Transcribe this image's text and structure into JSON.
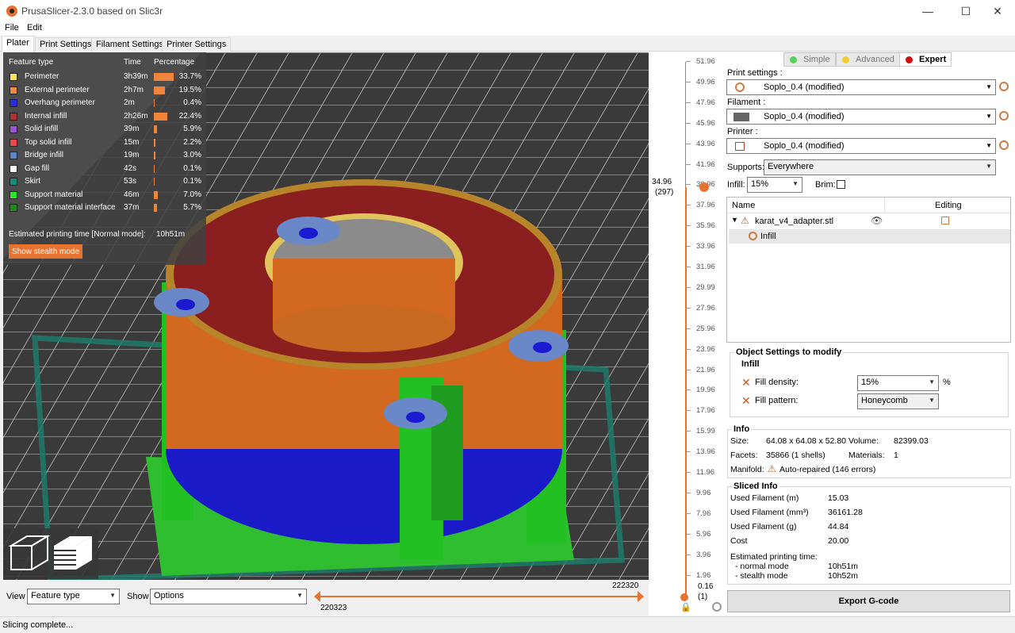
{
  "window": {
    "title": "PrusaSlicer-2.3.0 based on Slic3r",
    "minimize": "—",
    "maximize": "☐",
    "close": "✕"
  },
  "menu": {
    "file": "File",
    "edit": "Edit"
  },
  "tabs": [
    "Plater",
    "Print Settings",
    "Filament Settings",
    "Printer Settings"
  ],
  "legend": {
    "headers": {
      "feature": "Feature type",
      "time": "Time",
      "percentage": "Percentage"
    },
    "rows": [
      {
        "name": "Perimeter",
        "time": "3h39m",
        "pct": "33.7%",
        "value": 33.7,
        "color": "#ffe55a"
      },
      {
        "name": "External perimeter",
        "time": "2h7m",
        "pct": "19.5%",
        "value": 19.5,
        "color": "#f28a40"
      },
      {
        "name": "Overhang perimeter",
        "time": "2m",
        "pct": "0.4%",
        "value": 0.4,
        "color": "#2a2ae6"
      },
      {
        "name": "Internal infill",
        "time": "2h26m",
        "pct": "22.4%",
        "value": 22.4,
        "color": "#b03030"
      },
      {
        "name": "Solid infill",
        "time": "39m",
        "pct": "5.9%",
        "value": 5.9,
        "color": "#9a54d8"
      },
      {
        "name": "Top solid infill",
        "time": "15m",
        "pct": "2.2%",
        "value": 2.2,
        "color": "#f04848"
      },
      {
        "name": "Bridge infill",
        "time": "19m",
        "pct": "3.0%",
        "value": 3.0,
        "color": "#5a86c8"
      },
      {
        "name": "Gap fill",
        "time": "42s",
        "pct": "0.1%",
        "value": 0.1,
        "color": "#ffffff"
      },
      {
        "name": "Skirt",
        "time": "53s",
        "pct": "0.1%",
        "value": 0.1,
        "color": "#188a78"
      },
      {
        "name": "Support material",
        "time": "46m",
        "pct": "7.0%",
        "value": 7.0,
        "color": "#28e828"
      },
      {
        "name": "Support material interface",
        "time": "37m",
        "pct": "5.7%",
        "value": 5.7,
        "color": "#1e8a1e"
      }
    ],
    "estimated_label": "Estimated printing time [Normal mode]:",
    "estimated_value": "10h51m",
    "stealth_button": "Show stealth mode"
  },
  "viewbar": {
    "view_label": "View",
    "view_value": "Feature type",
    "show_label": "Show",
    "show_value": "Options",
    "range_start": "220323",
    "range_end": "222320"
  },
  "vslider": {
    "ticks": [
      "51.96",
      "49.96",
      "47.96",
      "45.96",
      "43.96",
      "41.96",
      "39.96",
      "37.96",
      "35.96",
      "33.96",
      "31.96",
      "29.99",
      "27.96",
      "25.96",
      "23.96",
      "21.96",
      "19.96",
      "17.96",
      "15.99",
      "13.96",
      "11.96",
      "9.96",
      "7.96",
      "5.96",
      "3.96",
      "1.96"
    ],
    "current_height": "34.96",
    "current_layer": "(297)",
    "bottom_height": "0.16",
    "bottom_layer": "(1)"
  },
  "modes": {
    "simple": "Simple",
    "advanced": "Advanced",
    "expert": "Expert"
  },
  "settings": {
    "print_label": "Print settings :",
    "print_value": "Soplo_0.4 (modified)",
    "filament_label": "Filament :",
    "filament_value": "Soplo_0.4 (modified)",
    "printer_label": "Printer :",
    "printer_value": "Soplo_0.4 (modified)",
    "supports_label": "Supports:",
    "supports_value": "Everywhere",
    "infill_label": "Infill:",
    "infill_value": "15%",
    "brim_label": "Brim:"
  },
  "objects": {
    "col_name": "Name",
    "col_editing": "Editing",
    "object_name": "karat_v4_adapter.stl",
    "child_name": "Infill"
  },
  "object_settings": {
    "title": "Object Settings to modify",
    "group": "Infill",
    "density_label": "Fill density:",
    "density_value": "15%",
    "density_unit": "%",
    "pattern_label": "Fill pattern:",
    "pattern_value": "Honeycomb"
  },
  "info": {
    "title": "Info",
    "size_label": "Size:",
    "size_value": "64.08 x 64.08 x 52.80",
    "volume_label": "Volume:",
    "volume_value": "82399.03",
    "facets_label": "Facets:",
    "facets_value": "35866 (1 shells)",
    "materials_label": "Materials:",
    "materials_value": "1",
    "manifold_label": "Manifold:",
    "manifold_value": "Auto-repaired (146 errors)"
  },
  "sliced": {
    "title": "Sliced Info",
    "rows": [
      {
        "label": "Used Filament (m)",
        "value": "15.03"
      },
      {
        "label": "Used Filament (mm³)",
        "value": "36161.28"
      },
      {
        "label": "Used Filament (g)",
        "value": "44.84"
      },
      {
        "label": "Cost",
        "value": "20.00"
      }
    ],
    "est_label": "Estimated printing time:",
    "normal_label": "- normal mode",
    "normal_value": "10h51m",
    "stealth_label": "- stealth mode",
    "stealth_value": "10h52m"
  },
  "export_button": "Export G-code",
  "status": "Slicing complete..."
}
